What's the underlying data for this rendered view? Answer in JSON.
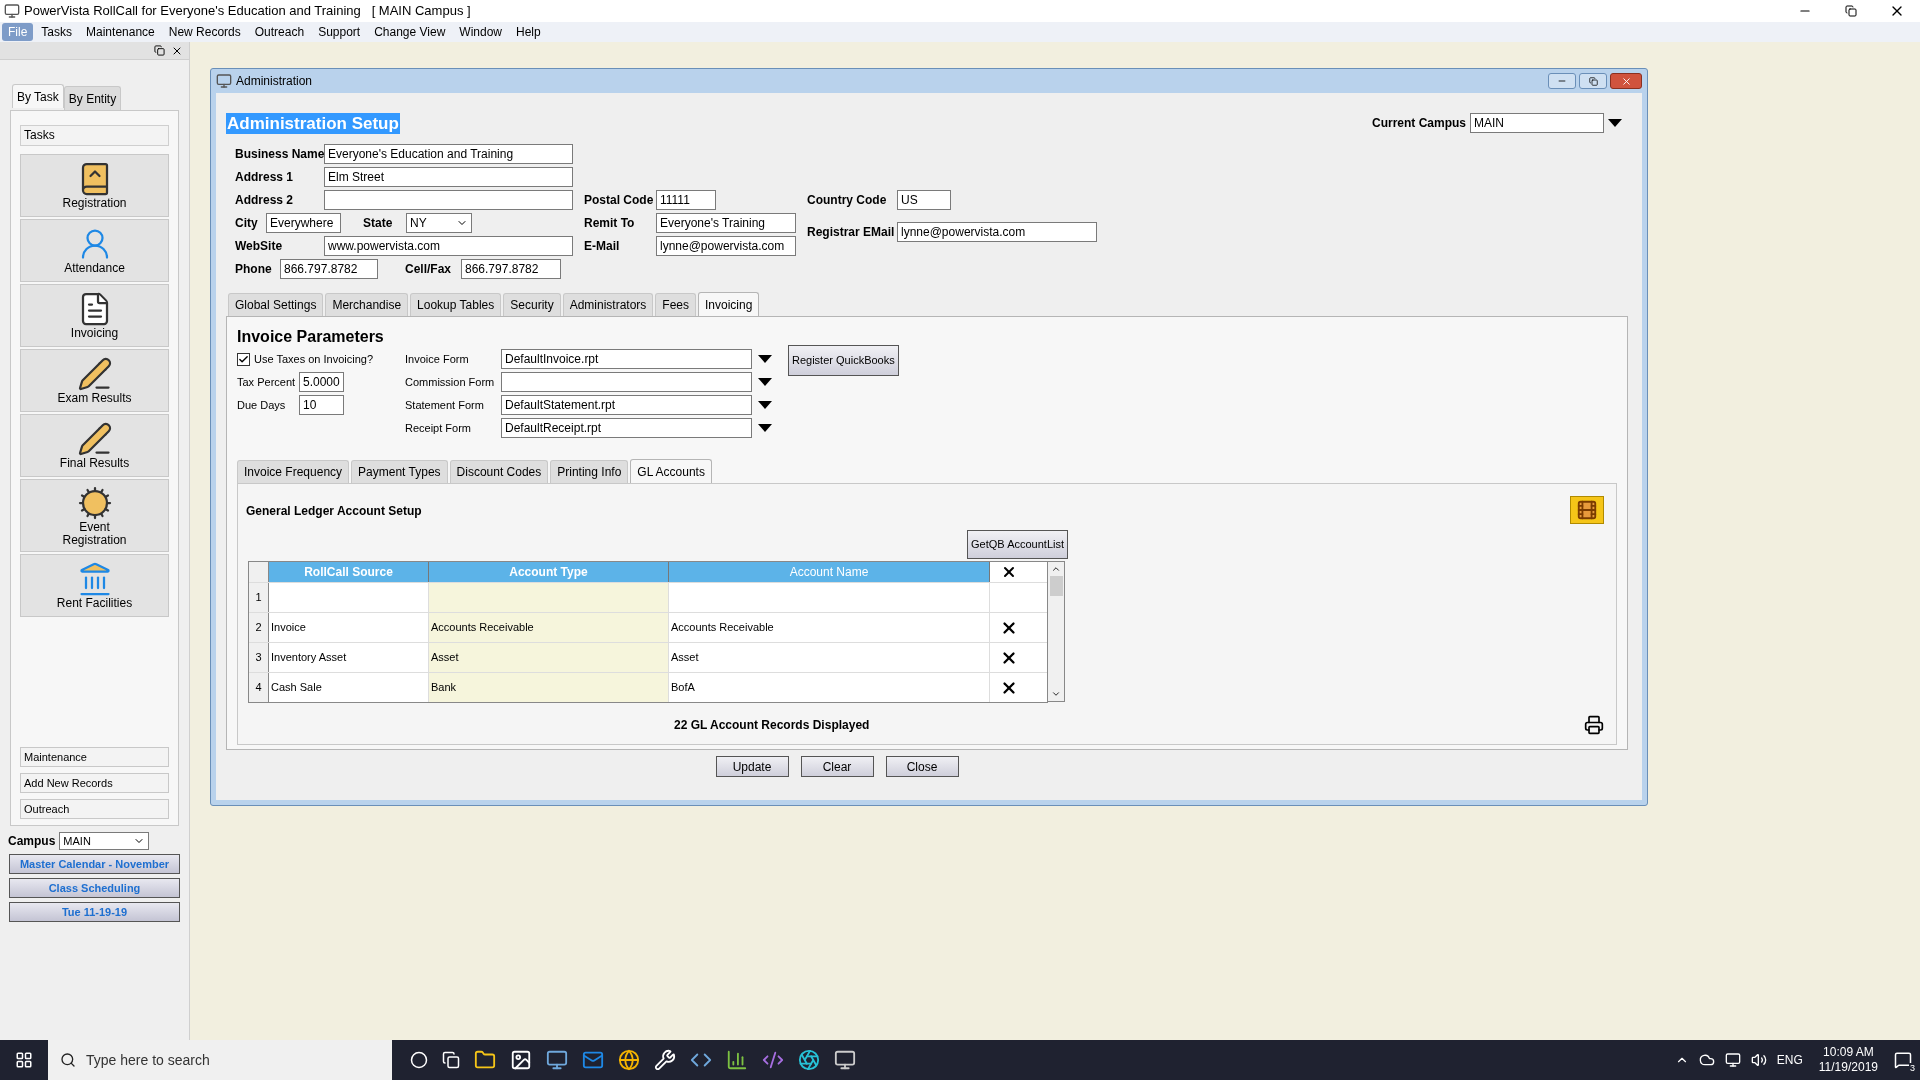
{
  "window": {
    "title": "PowerVista RollCall for Everyone's Education and Training   [ MAIN Campus ]"
  },
  "menu": [
    {
      "label": "File",
      "selected": true
    },
    {
      "label": "Tasks",
      "selected": false
    },
    {
      "label": "Maintenance",
      "selected": false
    },
    {
      "label": "New Records",
      "selected": false
    },
    {
      "label": "Outreach",
      "selected": false
    },
    {
      "label": "Support",
      "selected": false
    },
    {
      "label": "Change View",
      "selected": false
    },
    {
      "label": "Window",
      "selected": false
    },
    {
      "label": "Help",
      "selected": false
    }
  ],
  "sidebar": {
    "tabs": [
      {
        "label": "By Task",
        "selected": true
      },
      {
        "label": "By Entity",
        "selected": false
      }
    ],
    "header": "Tasks",
    "tasks": [
      {
        "label": "Registration",
        "kind": "registration"
      },
      {
        "label": "Attendance",
        "kind": "attendance"
      },
      {
        "label": "Invoicing",
        "kind": "invoicing"
      },
      {
        "label": "Exam Results",
        "kind": "exam"
      },
      {
        "label": "Final Results",
        "kind": "exam"
      },
      {
        "label": "Event Registration",
        "kind": "event"
      },
      {
        "label": "Rent Facilities",
        "kind": "rent"
      }
    ],
    "links": [
      "Maintenance",
      "Add New Records",
      "Outreach"
    ],
    "campus": {
      "label": "Campus",
      "value": "MAIN"
    },
    "buttons": [
      "Master Calendar - November",
      "Class Scheduling",
      "Tue 11-19-19"
    ]
  },
  "admin": {
    "title": "Administration",
    "heading": "Administration Setup",
    "current_campus": {
      "label": "Current Campus",
      "value": "MAIN"
    },
    "form": {
      "business_name": {
        "label": "Business Name",
        "value": "Everyone's Education and Training"
      },
      "address_1": {
        "label": "Address 1",
        "value": "Elm Street"
      },
      "address_2": {
        "label": "Address 2"
      },
      "city": {
        "label": "City",
        "value": "Everywhere"
      },
      "state": {
        "label": "State",
        "value": "NY"
      },
      "website": {
        "label": "WebSite",
        "value": "www.powervista.com"
      },
      "phone": {
        "label": "Phone",
        "value": "866.797.8782"
      },
      "cell_fax": {
        "label": "Cell/Fax",
        "value": "866.797.8782"
      },
      "postal_code": {
        "label": "Postal Code",
        "value": "11111"
      },
      "remit_to": {
        "label": "Remit To",
        "value": "Everyone's Training"
      },
      "email": {
        "label": "E-Mail",
        "value": "lynne@powervista.com"
      },
      "country_code": {
        "label": "Country Code",
        "value": "US"
      },
      "registrar_email": {
        "label": "Registrar EMail",
        "value": "lynne@powervista.com"
      }
    },
    "tabs": [
      {
        "label": "Global Settings",
        "selected": false
      },
      {
        "label": "Merchandise",
        "selected": false
      },
      {
        "label": "Lookup Tables",
        "selected": false
      },
      {
        "label": "Security",
        "selected": false
      },
      {
        "label": "Administrators",
        "selected": false
      },
      {
        "label": "Fees",
        "selected": false
      },
      {
        "label": "Invoicing",
        "selected": true
      }
    ],
    "invoice": {
      "heading": "Invoice Parameters",
      "use_taxes": {
        "label": "Use Taxes on Invoicing?",
        "checked": true
      },
      "tax_percent": {
        "label": "Tax Percent",
        "value": "5.0000"
      },
      "due_days": {
        "label": "Due Days",
        "value": "10"
      },
      "forms": [
        {
          "label": "Invoice Form",
          "value": "DefaultInvoice.rpt"
        },
        {
          "label": "Commission Form"
        },
        {
          "label": "Statement Form",
          "value": "DefaultStatement.rpt"
        },
        {
          "label": "Receipt Form",
          "value": "DefaultReceipt.rpt"
        }
      ],
      "register_button": "Register QuickBooks"
    },
    "subtabs": [
      {
        "label": "Invoice Frequency",
        "selected": false
      },
      {
        "label": "Payment Types",
        "selected": false
      },
      {
        "label": "Discount Codes",
        "selected": false
      },
      {
        "label": "Printing Info",
        "selected": false
      },
      {
        "label": "GL Accounts",
        "selected": true
      }
    ],
    "gl": {
      "title": "General Ledger Account Setup",
      "get_button": "GetQB AccountList",
      "columns": [
        "RollCall Source",
        "Account Type",
        "Account Name"
      ],
      "rows": [
        {
          "number": "1",
          "deletable": false
        },
        {
          "number": "2",
          "source": "Invoice",
          "type": "Accounts Receivable",
          "name": "Accounts Receivable",
          "deletable": true
        },
        {
          "number": "3",
          "source": "Inventory Asset",
          "type": "Asset",
          "name": "Asset",
          "deletable": true
        },
        {
          "number": "4",
          "source": "Cash Sale",
          "type": "Bank",
          "name": "BofA",
          "deletable": true
        }
      ],
      "footer": "22 GL Account Records Displayed"
    },
    "buttons": [
      "Update",
      "Clear",
      "Close"
    ]
  },
  "taskbar": {
    "search_placeholder": "Type here to search",
    "language": "ENG",
    "time": "10:09 AM",
    "date": "11/19/2019",
    "notifications": "3"
  }
}
